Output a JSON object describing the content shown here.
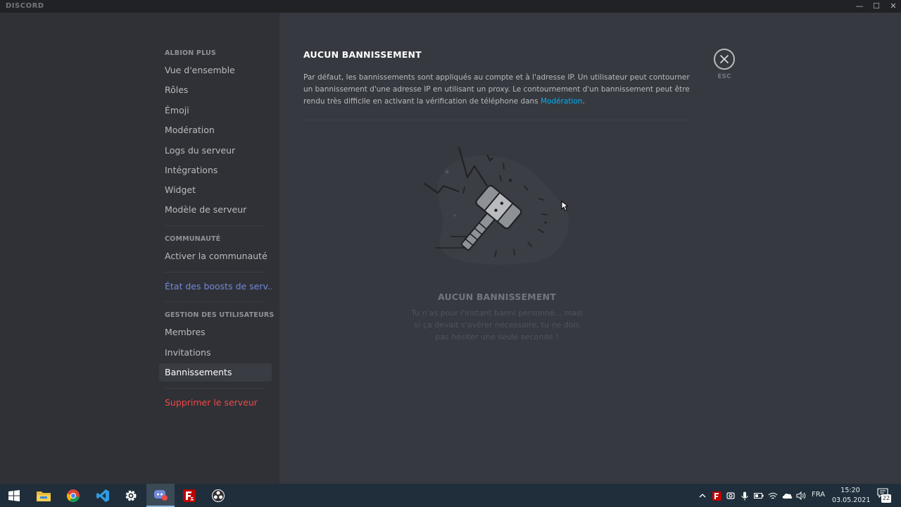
{
  "window": {
    "title": "DISCORD",
    "controls": {
      "minimize": "—",
      "maximize": "☐",
      "close": "✕"
    }
  },
  "sidebar": {
    "server_header": "ALBION PLUS",
    "server_items": [
      {
        "label": "Vue d'ensemble"
      },
      {
        "label": "Rôles"
      },
      {
        "label": "Émoji"
      },
      {
        "label": "Modération"
      },
      {
        "label": "Logs du serveur"
      },
      {
        "label": "Intégrations"
      },
      {
        "label": "Widget"
      },
      {
        "label": "Modèle de serveur"
      }
    ],
    "community_header": "COMMUNAUTÉ",
    "community_items": [
      {
        "label": "Activer la communauté"
      }
    ],
    "boost_label": "État des boosts de serv...",
    "users_header": "GESTION DES UTILISATEURS",
    "users_items": [
      {
        "label": "Membres"
      },
      {
        "label": "Invitations"
      },
      {
        "label": "Bannissements",
        "selected": true
      }
    ],
    "delete_label": "Supprimer le serveur"
  },
  "content": {
    "title": "AUCUN BANNISSEMENT",
    "description": "Par défaut, les bannissements sont appliqués au compte et à l'adresse IP. Un utilisateur peut contourner un bannissement d'une adresse IP en utilisant un proxy. Le contournement d'un bannissement peut être rendu très difficile en activant la vérification de téléphone dans ",
    "description_link": "Modération",
    "description_end": ".",
    "close_label": "ESC",
    "empty_title": "AUCUN BANNISSEMENT",
    "empty_text": "Tu n'as pour l'instant banni personne... mais si ça devait s'avérer nécessaire, tu ne dois pas hésiter une seule seconde !"
  },
  "taskbar": {
    "apps": [
      {
        "name": "windows-start-icon"
      },
      {
        "name": "file-explorer-icon"
      },
      {
        "name": "chrome-icon"
      },
      {
        "name": "vscode-icon"
      },
      {
        "name": "settings-gear-icon"
      },
      {
        "name": "discord-icon",
        "active": true
      },
      {
        "name": "filezilla-icon"
      },
      {
        "name": "obs-icon"
      }
    ],
    "tray": {
      "language": "FRA",
      "time": "15:20",
      "date": "03.05.2021",
      "notifications": "22"
    }
  },
  "colors": {
    "sidebar_bg": "#2f3136",
    "content_bg": "#36393f",
    "accent_link": "#00b0f4",
    "boost": "#7289da",
    "danger": "#f04747",
    "taskbar_bg": "#1f2e3a"
  }
}
